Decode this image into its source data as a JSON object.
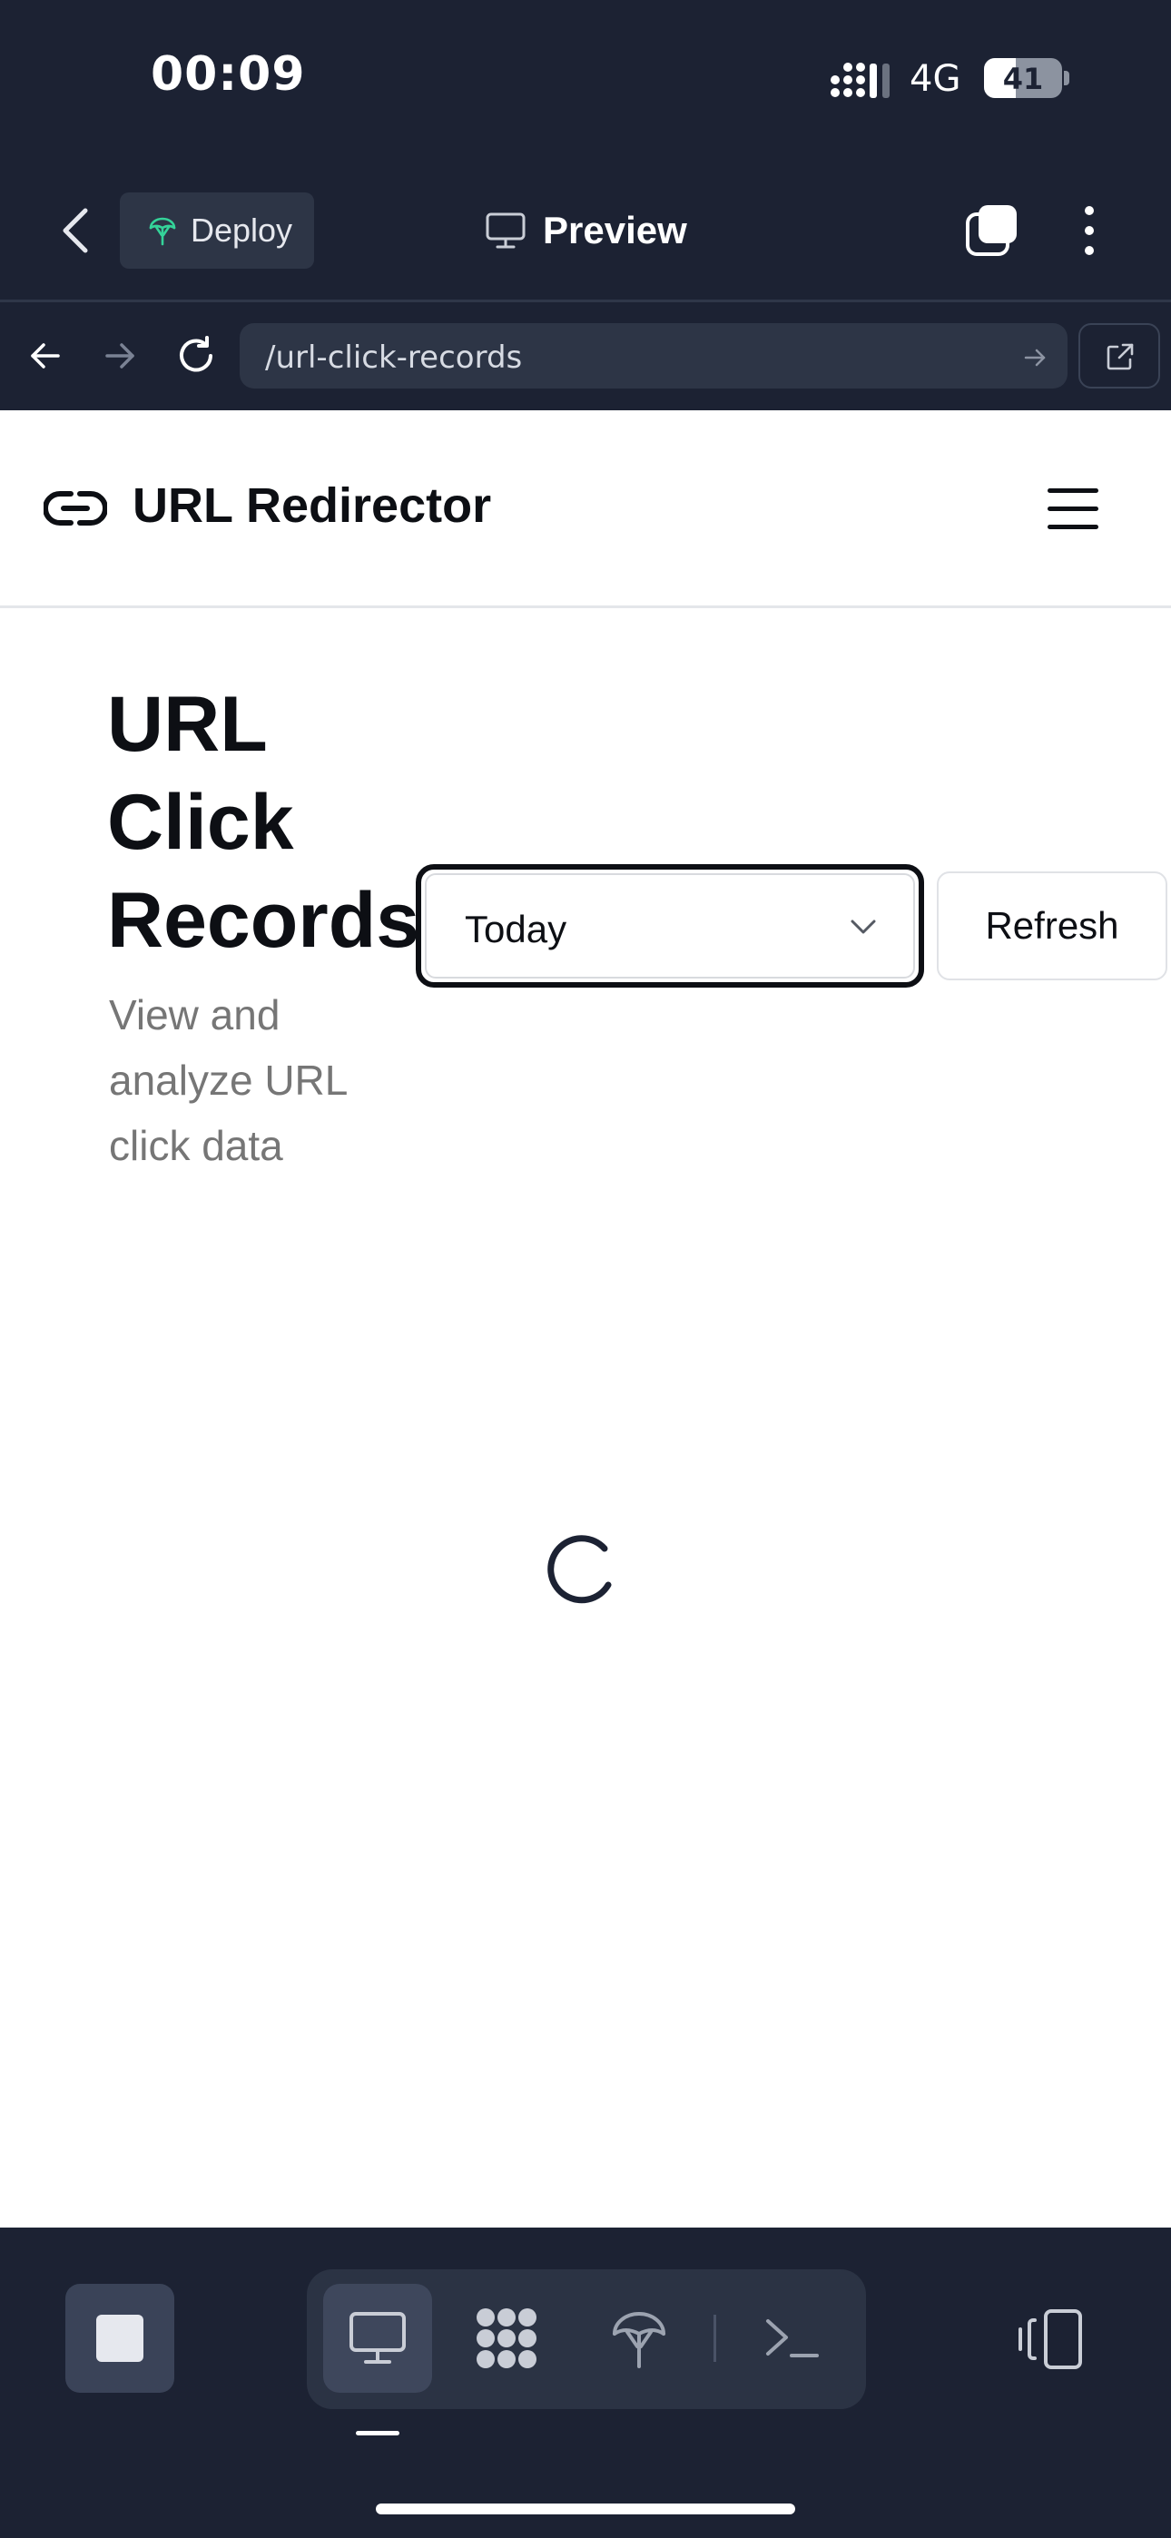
{
  "status_bar": {
    "time": "00:09",
    "network": "4G",
    "battery": "41",
    "battery_level": 0.41
  },
  "app_header": {
    "deploy_label": "Deploy",
    "preview_label": "Preview"
  },
  "browser": {
    "url": "/url-click-records"
  },
  "site": {
    "title": "URL Redirector"
  },
  "page": {
    "title": "URL Click Records",
    "subtitle": "View and analyze URL click data",
    "range_select": {
      "value": "Today"
    },
    "refresh_label": "Refresh"
  },
  "colors": {
    "app_bg": "#1c2233",
    "page_bg": "#ffffff",
    "text": "#0d0f14",
    "muted": "#767676",
    "deploy_icon": "#34d399"
  },
  "icons": [
    "back-chevron-icon",
    "deploy-icon",
    "monitor-icon",
    "tabs-icon",
    "more-icon",
    "arrow-left-icon",
    "arrow-right-icon",
    "reload-icon",
    "go-arrow-icon",
    "external-link-icon",
    "link-icon",
    "hamburger-menu-icon",
    "chevron-down-icon",
    "spinner-icon",
    "stop-icon",
    "monitor-icon",
    "apps-icon",
    "deploy-icon",
    "terminal-icon",
    "device-toggle-icon"
  ]
}
